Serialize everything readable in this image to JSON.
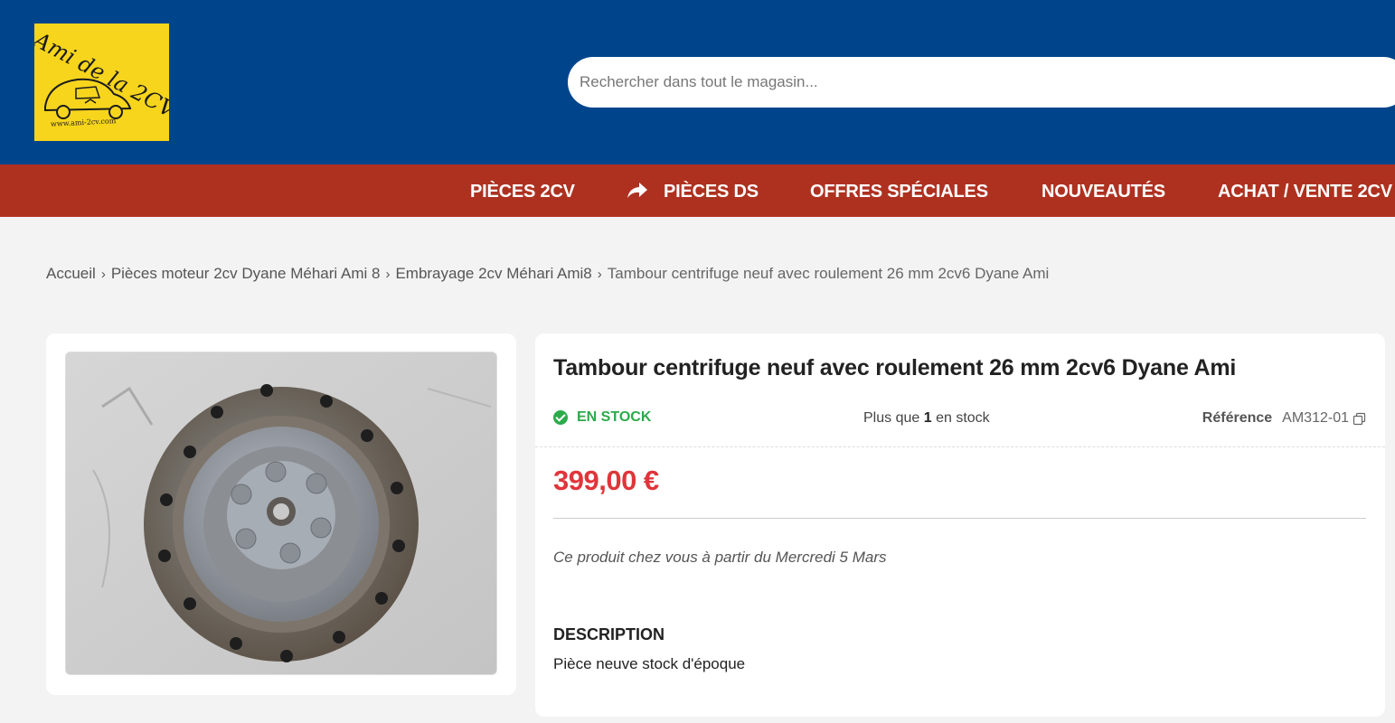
{
  "header": {
    "logo": {
      "text": "Ami de la 2CV",
      "url": "www.ami-2cv.com"
    },
    "search": {
      "placeholder": "Rechercher dans tout le magasin...",
      "value": ""
    }
  },
  "nav": {
    "items": [
      {
        "label": "PIÈCES 2CV"
      },
      {
        "label": "PIÈCES DS",
        "icon": "share-arrow-icon"
      },
      {
        "label": "OFFRES SPÉCIALES"
      },
      {
        "label": "NOUVEAUTÉS"
      },
      {
        "label": "ACHAT / VENTE 2CV"
      }
    ]
  },
  "breadcrumb": [
    "Accueil",
    "Pièces moteur 2cv Dyane Méhari Ami 8",
    "Embrayage 2cv Méhari Ami8",
    "Tambour centrifuge neuf avec roulement 26 mm 2cv6 Dyane Ami"
  ],
  "product": {
    "title": "Tambour centrifuge neuf avec roulement 26 mm 2cv6 Dyane Ami",
    "stock_status": "EN STOCK",
    "qty_prefix": "Plus que",
    "qty_value": "1",
    "qty_suffix": "en stock",
    "reference_label": "Référence",
    "reference_value": "AM312-01",
    "price": "399,00 €",
    "delivery": "Ce produit chez vous à partir du Mercredi 5 Mars",
    "description_heading": "DESCRIPTION",
    "description_text": "Pièce neuve stock d'époque"
  },
  "colors": {
    "header_bg": "#00458c",
    "nav_bg": "#ae3120",
    "logo_bg": "#f7d51d",
    "stock_green": "#2bab4a",
    "price_red": "#e0353b"
  }
}
